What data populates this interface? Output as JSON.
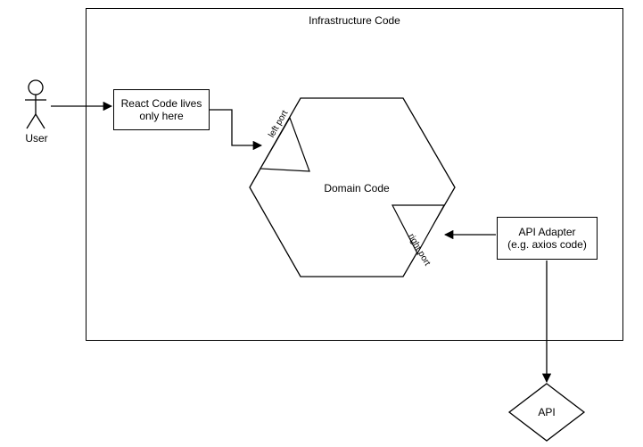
{
  "title": "Infrastructure Code",
  "user_label": "User",
  "react_box": "React Code lives only here",
  "hexagon_label": "Domain Code",
  "left_port_label": "left port",
  "right_port_label": "right port",
  "api_adapter_line1": "API Adapter",
  "api_adapter_line2": "(e.g. axios code)",
  "api_diamond": "API"
}
